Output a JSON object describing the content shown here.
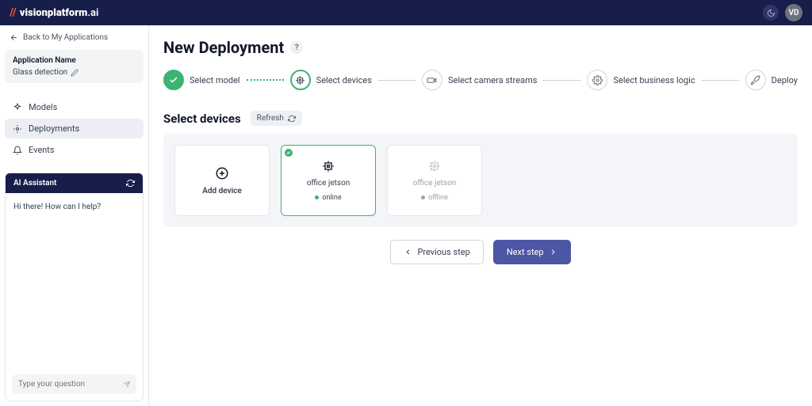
{
  "brand": {
    "name": "visionplatform",
    "suffix": ".ai"
  },
  "user": {
    "initials": "VD"
  },
  "sidebar": {
    "back_label": "Back to My Applications",
    "app_name_label": "Application Name",
    "app_name_value": "Glass detection",
    "nav": [
      {
        "label": "Models"
      },
      {
        "label": "Deployments"
      },
      {
        "label": "Events"
      }
    ]
  },
  "assistant": {
    "title": "AI Assistant",
    "greeting": "Hi there! How can I help?",
    "placeholder": "Type your question"
  },
  "page": {
    "title": "New Deployment",
    "section_title": "Select devices",
    "refresh_label": "Refresh"
  },
  "steps": [
    {
      "label": "Select model"
    },
    {
      "label": "Select devices"
    },
    {
      "label": "Select camera streams"
    },
    {
      "label": "Select business logic"
    },
    {
      "label": "Deploy"
    }
  ],
  "devices": {
    "add_label": "Add device",
    "cards": [
      {
        "name": "office jetson",
        "status": "online"
      },
      {
        "name": "office jetson",
        "status": "offline"
      }
    ]
  },
  "actions": {
    "prev": "Previous step",
    "next": "Next step"
  }
}
